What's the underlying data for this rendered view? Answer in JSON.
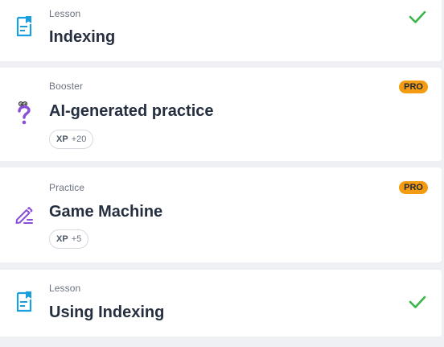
{
  "items": [
    {
      "type_label": "Lesson",
      "title": "Indexing",
      "icon": "lesson-document-icon",
      "status": "completed"
    },
    {
      "type_label": "Booster",
      "title": "AI-generated practice",
      "icon": "question-mark-icon",
      "badge": "PRO",
      "xp_label": "XP",
      "xp_value": "+20"
    },
    {
      "type_label": "Practice",
      "title": "Game Machine",
      "icon": "pencil-icon",
      "badge": "PRO",
      "xp_label": "XP",
      "xp_value": "+5"
    },
    {
      "type_label": "Lesson",
      "title": "Using Indexing",
      "icon": "lesson-document-icon",
      "status": "completed"
    }
  ],
  "colors": {
    "lesson_icon": "#1a9fde",
    "booster_icon": "#8a4fd8",
    "practice_icon": "#8a4fd8",
    "check": "#3bb54a",
    "pro_badge": "#f39c12",
    "background": "#eef0f4"
  }
}
